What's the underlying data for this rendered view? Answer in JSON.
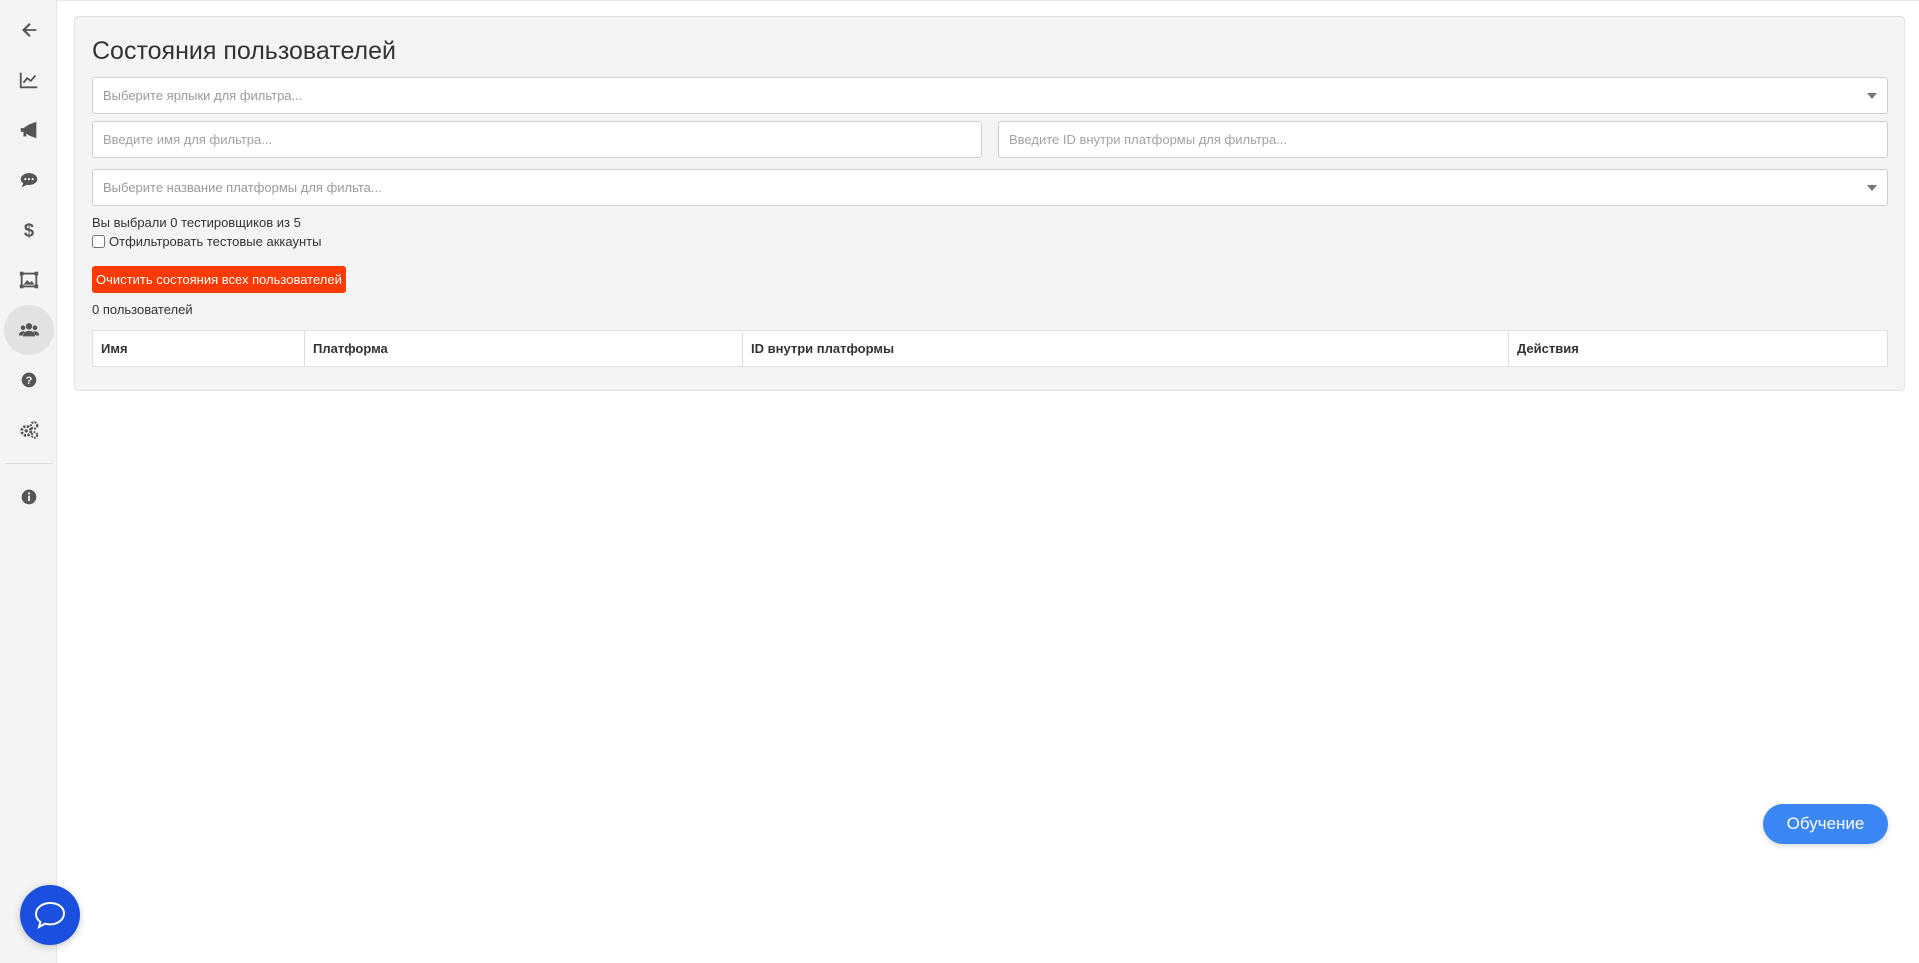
{
  "sidebar": {
    "items": [
      {
        "icon": "arrow-left-icon"
      },
      {
        "icon": "line-chart-icon"
      },
      {
        "icon": "megaphone-icon"
      },
      {
        "icon": "comment-icon"
      },
      {
        "icon": "dollar-icon"
      },
      {
        "icon": "image-frame-icon"
      },
      {
        "icon": "users-icon",
        "active": true
      },
      {
        "icon": "question-icon"
      },
      {
        "icon": "gears-icon"
      },
      {
        "icon": "info-icon"
      }
    ]
  },
  "page": {
    "title": "Состояния пользователей"
  },
  "filters": {
    "labels_placeholder": "Выберите ярлыки для фильтра...",
    "name_placeholder": "Введите имя для фильтра...",
    "platform_id_placeholder": "Введите ID внутри платформы для фильтра...",
    "platform_name_placeholder": "Выберите название платформы для фильта..."
  },
  "testers_info": "Вы выбрали 0 тестировщиков из 5",
  "filter_test_accounts_label": "Отфильтровать тестовые аккаунты",
  "clear_button_label": "Очистить состояния всех пользователей",
  "users_count": "0 пользователей",
  "table": {
    "columns": [
      "Имя",
      "Платформа",
      "ID внутри платформы",
      "Действия"
    ]
  },
  "learn_button_label": "Обучение",
  "colors": {
    "danger": "#ff3a00",
    "primary": "#3a86f5",
    "chat": "#1a4fe0"
  }
}
